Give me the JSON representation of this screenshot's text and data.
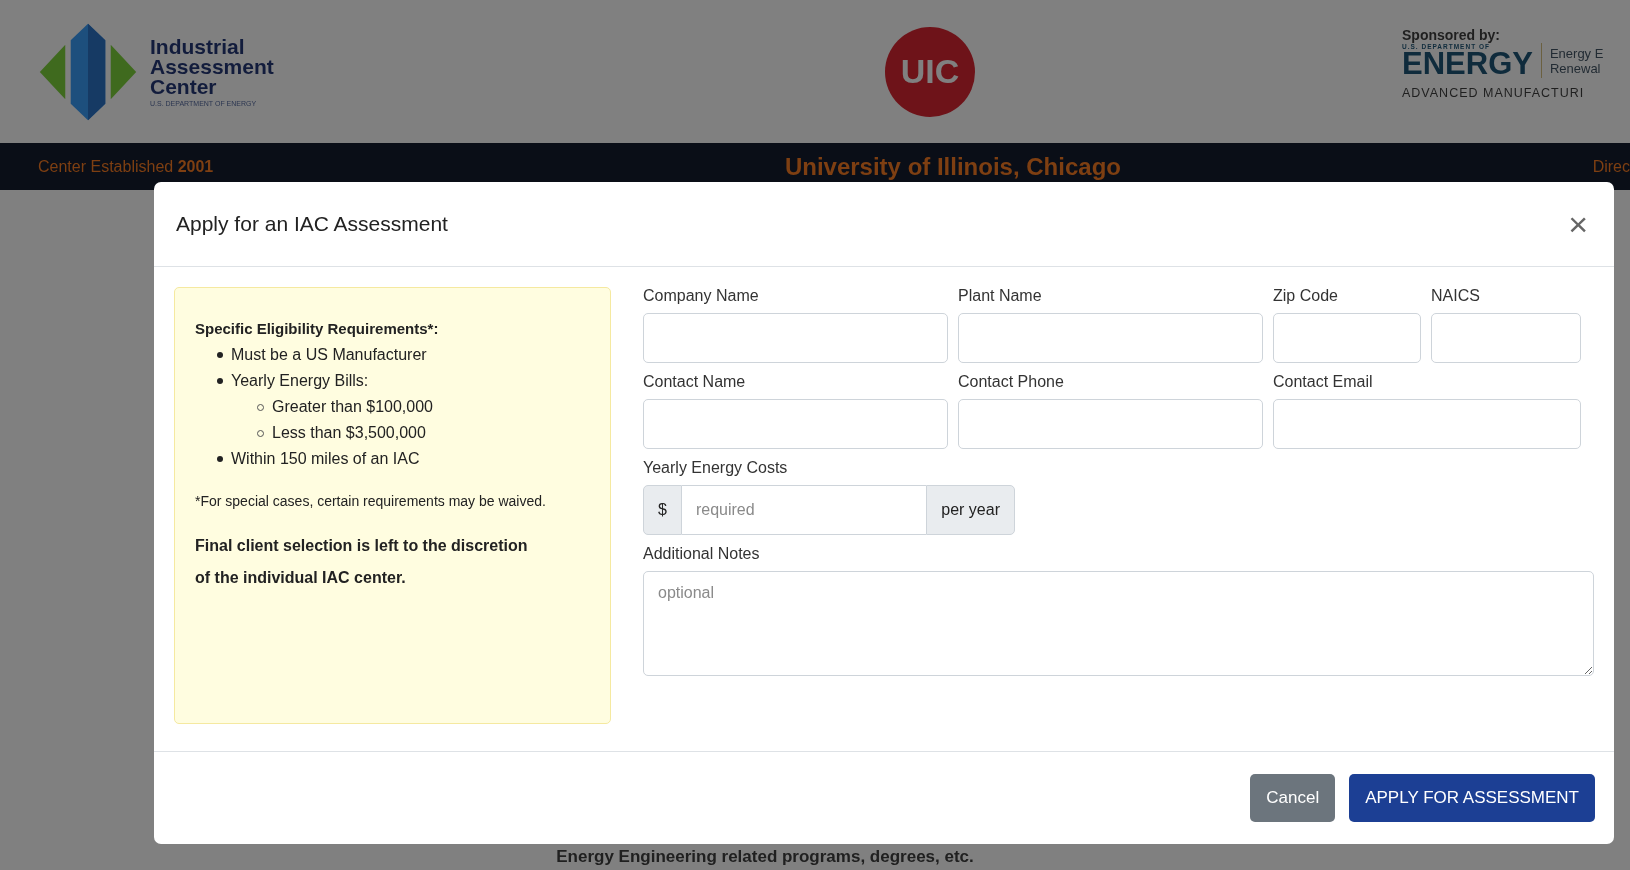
{
  "header": {
    "iac_logo": {
      "line1": "Industrial",
      "line2": "Assessment",
      "line3": "Center",
      "subline": "U.S. DEPARTMENT OF ENERGY"
    },
    "uic_logo": {
      "text": "UIC"
    },
    "sponsor": {
      "label": "Sponsored by:",
      "doe_small": "U.S. DEPARTMENT OF",
      "doe_big": "ENERGY",
      "office_line1": "Energy E",
      "office_line2": "Renewal",
      "program": "ADVANCED MANUFACTURI"
    }
  },
  "info_bar": {
    "left_label": "Center Established ",
    "left_year": "2001",
    "center": "University of Illinois, Chicago",
    "right": "Direc"
  },
  "background_text": "Energy Engineering related programs, degrees, etc.",
  "modal": {
    "title": "Apply for an IAC Assessment",
    "close": "×",
    "eligibility": {
      "title": "Specific Eligibility Requirements*:",
      "items": [
        {
          "text": "Must be a US Manufacturer"
        },
        {
          "text": "Yearly Energy Bills:",
          "children": [
            {
              "text": "Greater than $100,000"
            },
            {
              "text": "Less than $3,500,000"
            }
          ]
        },
        {
          "text": "Within 150 miles of an IAC"
        }
      ],
      "note": "*For special cases, certain requirements may be waived.",
      "final": "Final client selection is left to the discretion of the individual IAC center."
    },
    "fields": [
      {
        "label": "Company Name"
      },
      {
        "label": "Plant Name"
      },
      {
        "label": "Zip Code"
      },
      {
        "label": "NAICS"
      },
      {
        "label": "Contact Name"
      },
      {
        "label": "Contact Phone"
      },
      {
        "label": "Contact Email"
      }
    ],
    "energy_costs": {
      "label": "Yearly Energy Costs",
      "prefix": "$",
      "placeholder": "required",
      "suffix": "per year"
    },
    "notes": {
      "label": "Additional Notes",
      "placeholder": "optional"
    },
    "buttons": [
      {
        "label": "Cancel",
        "kind": "secondary"
      },
      {
        "label": "APPLY FOR ASSESSMENT",
        "kind": "primary"
      }
    ]
  }
}
